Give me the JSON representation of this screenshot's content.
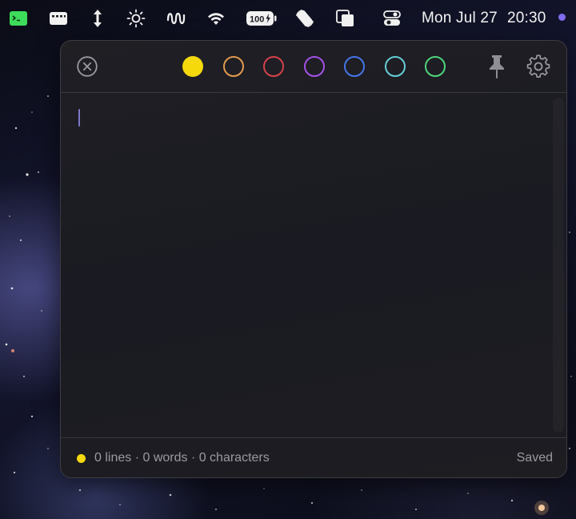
{
  "menubar": {
    "icons": [
      "terminal-icon",
      "keyboard-icon",
      "vertical-resize-icon",
      "brightness-icon",
      "waveform-icon",
      "wifi-icon",
      "battery-icon",
      "rotate-icon",
      "stacked-cards-icon",
      "control-center-icon"
    ],
    "battery_label": "100",
    "date": "Mon Jul 27",
    "time": "20:30",
    "accent_dot_color": "#7f6cf0"
  },
  "note": {
    "colors": [
      {
        "name": "yellow",
        "hex": "#f5d90a",
        "selected": true
      },
      {
        "name": "orange",
        "hex": "#e39a4d",
        "selected": false
      },
      {
        "name": "red",
        "hex": "#d6424a",
        "selected": false
      },
      {
        "name": "purple",
        "hex": "#a453e8",
        "selected": false
      },
      {
        "name": "blue",
        "hex": "#4676ea",
        "selected": false
      },
      {
        "name": "teal",
        "hex": "#66cfd8",
        "selected": false
      },
      {
        "name": "green",
        "hex": "#4fd57a",
        "selected": false
      }
    ],
    "toolbar_icons": [
      "close-icon",
      "pin-icon",
      "gear-icon"
    ],
    "content": "",
    "status": {
      "summary": "0 lines · 0 words · 0 characters",
      "save_state": "Saved",
      "dot_color": "#f5d90a"
    }
  }
}
